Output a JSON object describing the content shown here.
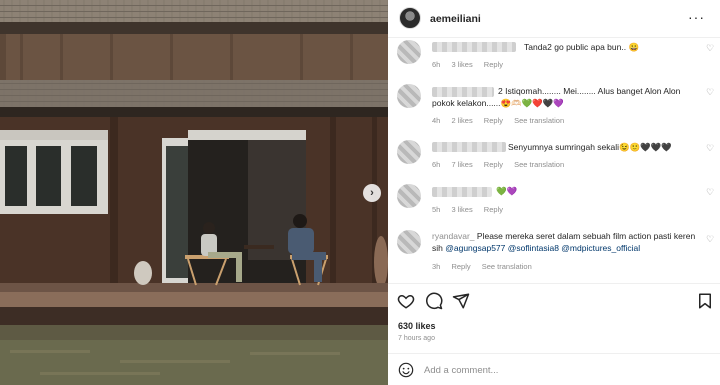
{
  "post": {
    "username": "aemeiliani",
    "likes": "630 likes",
    "time": "7 hours ago"
  },
  "comments": [
    {
      "text": "Tanda2 go public apa bun.. 😀",
      "age": "6h",
      "likes": "3 likes",
      "reply": "Reply",
      "translation": ""
    },
    {
      "text": "2 Istiqomah........ Mei........ Alus banget Alon Alon pokok kelakon......😍🫶🏻💚❤️🖤💜",
      "age": "4h",
      "likes": "2 likes",
      "reply": "Reply",
      "translation": "See translation"
    },
    {
      "text": "Senyumnya sumringah sekali😉🙂🖤🖤🖤",
      "age": "6h",
      "likes": "7 likes",
      "reply": "Reply",
      "translation": "See translation"
    },
    {
      "text": "💚💜",
      "age": "5h",
      "likes": "3 likes",
      "reply": "Reply",
      "translation": ""
    },
    {
      "text_prefix": "Please mereka seret dalam sebuah film action pasti keren sih ",
      "mentions": [
        "@agungsap577",
        "@soflintasia8",
        "@mdpictures_official"
      ],
      "age": "3h",
      "likes": "",
      "reply": "Reply",
      "translation": "See translation",
      "user_fragment": "ryandavar_"
    }
  ],
  "add_comment": {
    "placeholder": "Add a comment..."
  },
  "icons": {
    "like": "heart-icon",
    "comment": "comment-icon",
    "share": "share-icon",
    "save": "bookmark-icon",
    "emoji": "smiley-icon",
    "more": "more-icon",
    "next": "chevron-right-icon"
  }
}
